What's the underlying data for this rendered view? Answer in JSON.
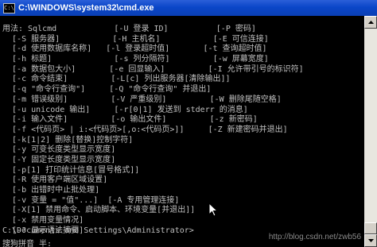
{
  "window": {
    "title": "C:\\WINDOWS\\system32\\cmd.exe",
    "icon_label": "C:\\"
  },
  "console": {
    "lines": [
      "用法: Sqlcmd            [-U 登录 ID]          [-P 密码]",
      "  [-S 服务器]           [-H 主机名]           [-E 可信连接]",
      "  [-d 使用数据库名称]   [-l 登录超时值]       [-t 查询超时值]",
      "  [-h 标题]             [-s 列分隔符]         [-w 屏幕宽度]",
      "  [-a 数据包大小]       [-e 回显输入]         [-I 允许带引号的标识符]",
      "  [-c 命令结束]         [-L[c] 列出服务器[清除输出]]",
      "  [-q \"命令行查询\"]     [-Q \"命令行查询\" 并退出]",
      "  [-m 错误级别]         [-V 严重级别]         [-W 删除尾随空格]",
      "  [-u unicode 输出]     [-r[0|1] 发送到 stderr 的消息]",
      "  [-i 输入文件]         [-o 输出文件]         [-z 新密码]",
      "  [-f <代码页> | i:<代码页>[,o:<代码页>]]     [-Z 新建密码并退出]",
      "  [-k[1|2] 删除[替换]控制字符]",
      "  [-y 可变长度类型显示宽度]",
      "  [-Y 固定长度类型显示宽度]",
      "  [-p[1] 打印统计信息[冒号格式]]",
      "  [-R 使用客户端区域设置]",
      "  [-b 出错时中止批处理]",
      "  [-v 变量 = \"值\"...]  [-A 专用管理连接]",
      "  [-X[1] 禁用命令、启动脚本、环境变量[并退出]]",
      "  [-x 禁用变量情况]",
      "  [-? 显示语法摘要]"
    ],
    "prompt": "C:\\Documents and Settings\\Administrator>",
    "ime_status": "搜狗拼音 半:",
    "watermark": "http://blog.csdn.net/zwb56"
  },
  "colors": {
    "console_bg": "#000000",
    "console_fg": "#c0c0c0",
    "titlebar": "#0a46c8"
  },
  "icons": [
    "cmd-window-icon",
    "scroll-up-arrow-icon",
    "scroll-down-arrow-icon",
    "mouse-pointer-icon"
  ]
}
